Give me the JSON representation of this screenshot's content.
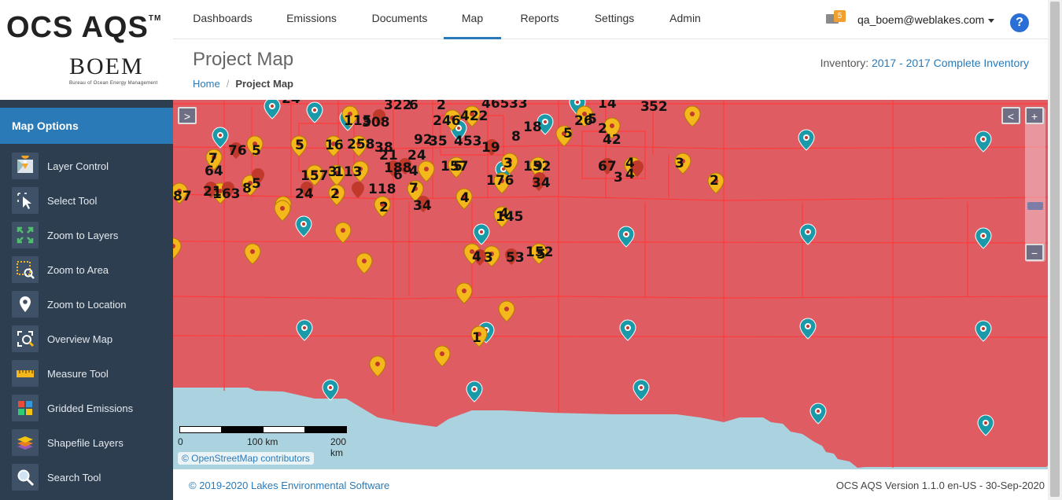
{
  "brand": {
    "name": "OCS AQS",
    "tm": "TM",
    "agency": "BOEM",
    "agency_full": "Bureau of Ocean Energy Management"
  },
  "nav": {
    "items": [
      {
        "label": "Dashboards"
      },
      {
        "label": "Emissions"
      },
      {
        "label": "Documents"
      },
      {
        "label": "Map"
      },
      {
        "label": "Reports"
      },
      {
        "label": "Settings"
      },
      {
        "label": "Admin"
      }
    ],
    "active": "Map",
    "mail_count": "5",
    "user": "qa_boem@weblakes.com",
    "help": "?"
  },
  "header": {
    "title": "Project Map",
    "breadcrumb": {
      "home": "Home",
      "current": "Project Map"
    },
    "inventory_label": "Inventory:",
    "inventory_value": "2017 - 2017 Complete Inventory"
  },
  "sidebar": {
    "title": "Map Options",
    "items": [
      {
        "label": "Layer Control",
        "icon": "layer-control-icon"
      },
      {
        "label": "Select Tool",
        "icon": "select-tool-icon"
      },
      {
        "label": "Zoom to Layers",
        "icon": "zoom-to-layers-icon"
      },
      {
        "label": "Zoom to Area",
        "icon": "zoom-to-area-icon"
      },
      {
        "label": "Zoom to Location",
        "icon": "zoom-to-location-icon"
      },
      {
        "label": "Overview Map",
        "icon": "overview-map-icon"
      },
      {
        "label": "Measure Tool",
        "icon": "measure-tool-icon"
      },
      {
        "label": "Gridded Emissions",
        "icon": "gridded-emissions-icon"
      },
      {
        "label": "Shapefile Layers",
        "icon": "shapefile-layers-icon"
      },
      {
        "label": "Search Tool",
        "icon": "search-tool-icon"
      }
    ]
  },
  "map": {
    "expand_label": ">",
    "collapse_label": "<",
    "zoom_in": "+",
    "zoom_out": "−",
    "scale": {
      "l0": "0",
      "l1": "100 km",
      "l2": "200 km"
    },
    "attribution": "© OpenStreetMap contributors",
    "colors": {
      "region": "#df5c63",
      "water": "#aad3df",
      "grid": "#ff3b3b",
      "pin_teal": "#1a9aa8",
      "pin_orange": "#f5b81c",
      "pin_red": "#c0392b"
    }
  },
  "footer": {
    "copyright": "© 2019-2020 Lakes Environmental Software",
    "version": "OCS AQS Version 1.1.0 en-US - 30-Sep-2020"
  }
}
